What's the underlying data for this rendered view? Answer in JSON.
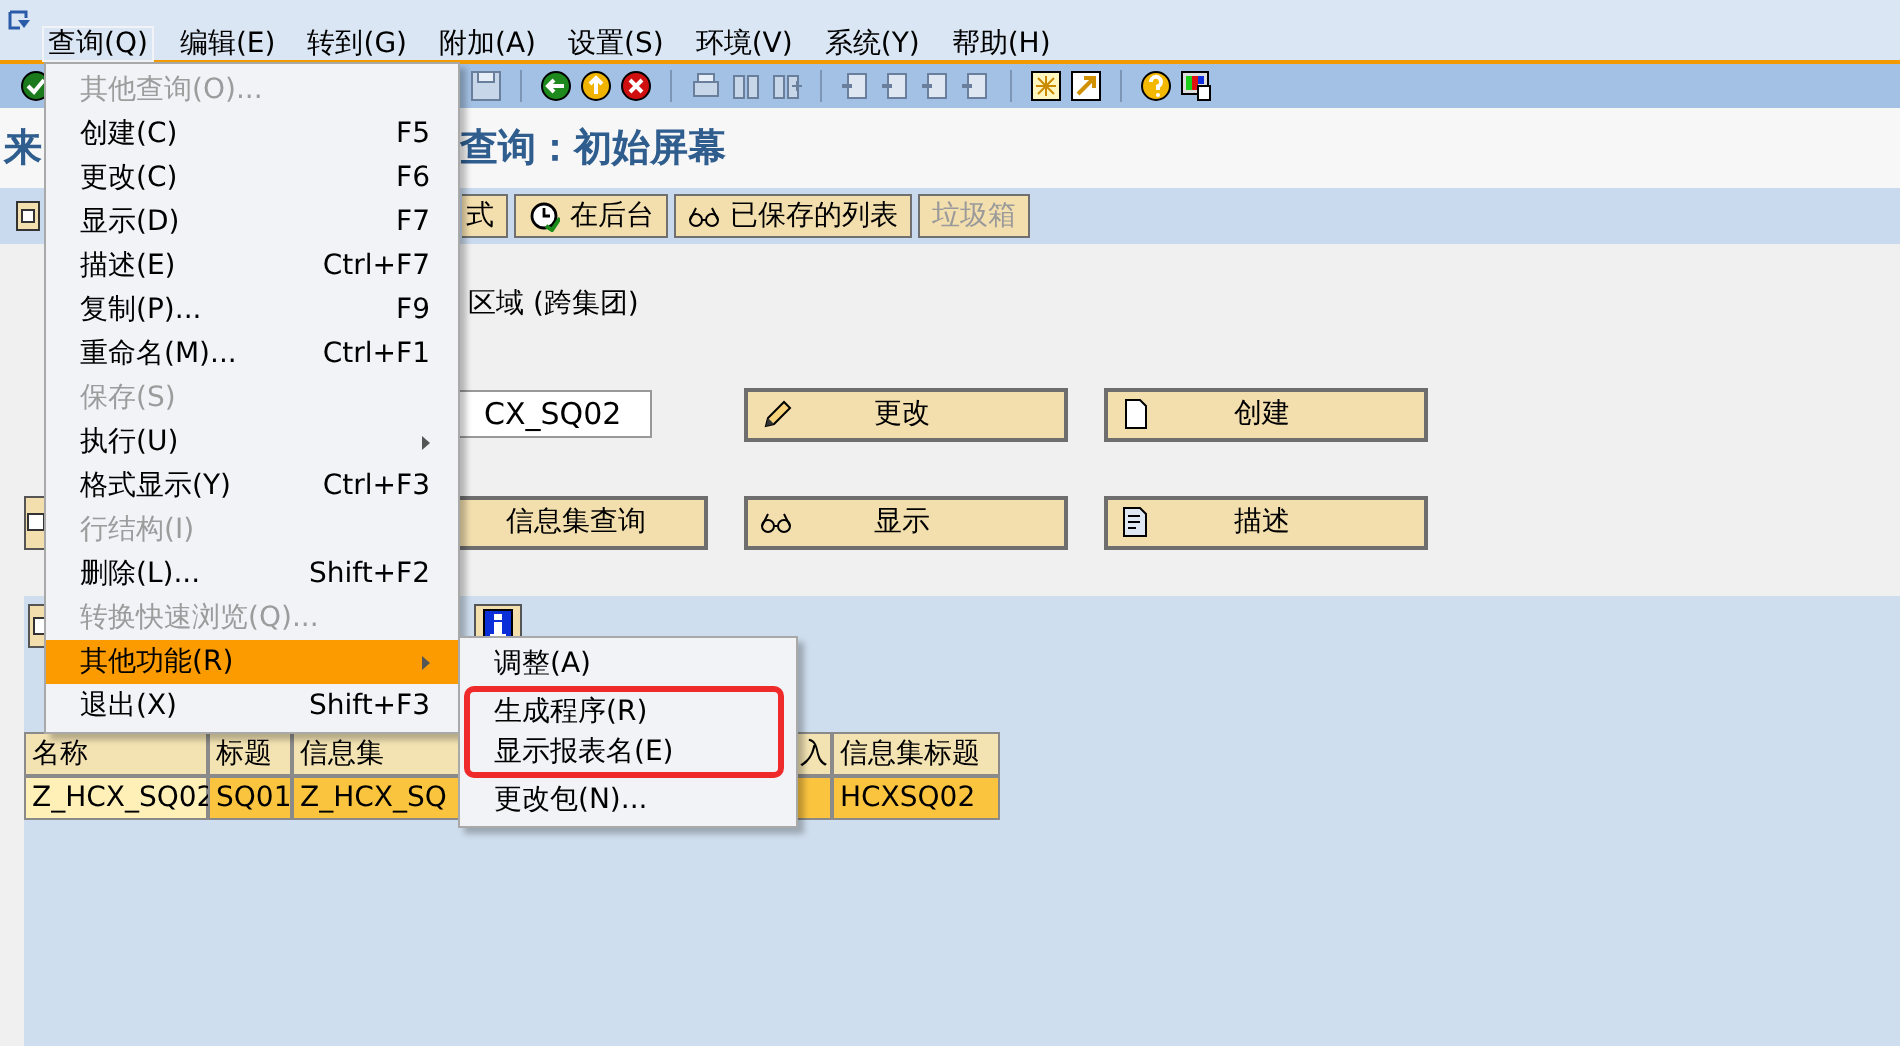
{
  "menubar": [
    {
      "label": "查询(Q)",
      "selected": true
    },
    {
      "label": "编辑(E)",
      "selected": false
    },
    {
      "label": "转到(G)",
      "selected": false
    },
    {
      "label": "附加(A)",
      "selected": false
    },
    {
      "label": "设置(S)",
      "selected": false
    },
    {
      "label": "环境(V)",
      "selected": false
    },
    {
      "label": "系统(Y)",
      "selected": false
    },
    {
      "label": "帮助(H)",
      "selected": false
    }
  ],
  "title": {
    "left_part": "来",
    "right_part": "查询：初始屏幕"
  },
  "app_toolbar": [
    {
      "label": "式",
      "disabled": false
    },
    {
      "label": "在后台",
      "disabled": false
    },
    {
      "label": "已保存的列表",
      "disabled": false
    },
    {
      "label": "垃圾箱",
      "disabled": true
    }
  ],
  "form": {
    "row_1_text": "区域 (跨集团)",
    "query_field": {
      "value": "CX_SQ02"
    },
    "buttons": [
      {
        "label": "更改"
      },
      {
        "label": "创建"
      },
      {
        "label": "信息集查询"
      },
      {
        "label": "显示"
      },
      {
        "label": "描述"
      }
    ]
  },
  "list": {
    "table": {
      "columns": [
        "名称",
        "标题",
        "信息集",
        "入",
        "信息集标题"
      ],
      "rows": [
        [
          "Z_HCX_SQ02",
          "SQ01",
          "Z_HCX_SQ",
          "",
          "HCXSQ02"
        ]
      ]
    }
  },
  "menu": [
    {
      "label": "其他查询(O)...",
      "disabled": true,
      "submenu": false,
      "selected": false
    },
    {
      "label": "创建(C)",
      "shortcut": "F5",
      "disabled": false,
      "submenu": false,
      "selected": false
    },
    {
      "label": "更改(C)",
      "shortcut": "F6",
      "disabled": false,
      "submenu": false,
      "selected": false
    },
    {
      "label": "显示(D)",
      "shortcut": "F7",
      "disabled": false,
      "submenu": false,
      "selected": false
    },
    {
      "label": "描述(E)",
      "shortcut": "Ctrl+F7",
      "disabled": false,
      "submenu": false,
      "selected": false
    },
    {
      "label": "复制(P)...",
      "shortcut": "F9",
      "disabled": false,
      "submenu": false,
      "selected": false
    },
    {
      "label": "重命名(M)...",
      "shortcut": "Ctrl+F1",
      "disabled": false,
      "submenu": false,
      "selected": false
    },
    {
      "label": "保存(S)",
      "disabled": true,
      "submenu": false,
      "selected": false
    },
    {
      "label": "执行(U)",
      "disabled": false,
      "submenu": true,
      "selected": false
    },
    {
      "label": "格式显示(Y)",
      "shortcut": "Ctrl+F3",
      "disabled": false,
      "submenu": false,
      "selected": false
    },
    {
      "label": "行结构(I)",
      "disabled": true,
      "submenu": false,
      "selected": false
    },
    {
      "label": "删除(L)...",
      "shortcut": "Shift+F2",
      "disabled": false,
      "submenu": false,
      "selected": false
    },
    {
      "label": "转换快速浏览(Q)...",
      "disabled": true,
      "submenu": false,
      "selected": false
    },
    {
      "label": "其他功能(R)",
      "disabled": false,
      "submenu": true,
      "selected": true
    },
    {
      "label": "退出(X)",
      "shortcut": "Shift+F3",
      "disabled": false,
      "submenu": false,
      "selected": false
    }
  ],
  "submenu": [
    {
      "label": "调整(A)",
      "highlighted": false
    },
    {
      "label": "生成程序(R)",
      "highlighted": true
    },
    {
      "label": "显示报表名(E)",
      "highlighted": true
    },
    {
      "label": "更改包(N)...",
      "highlighted": false
    }
  ]
}
